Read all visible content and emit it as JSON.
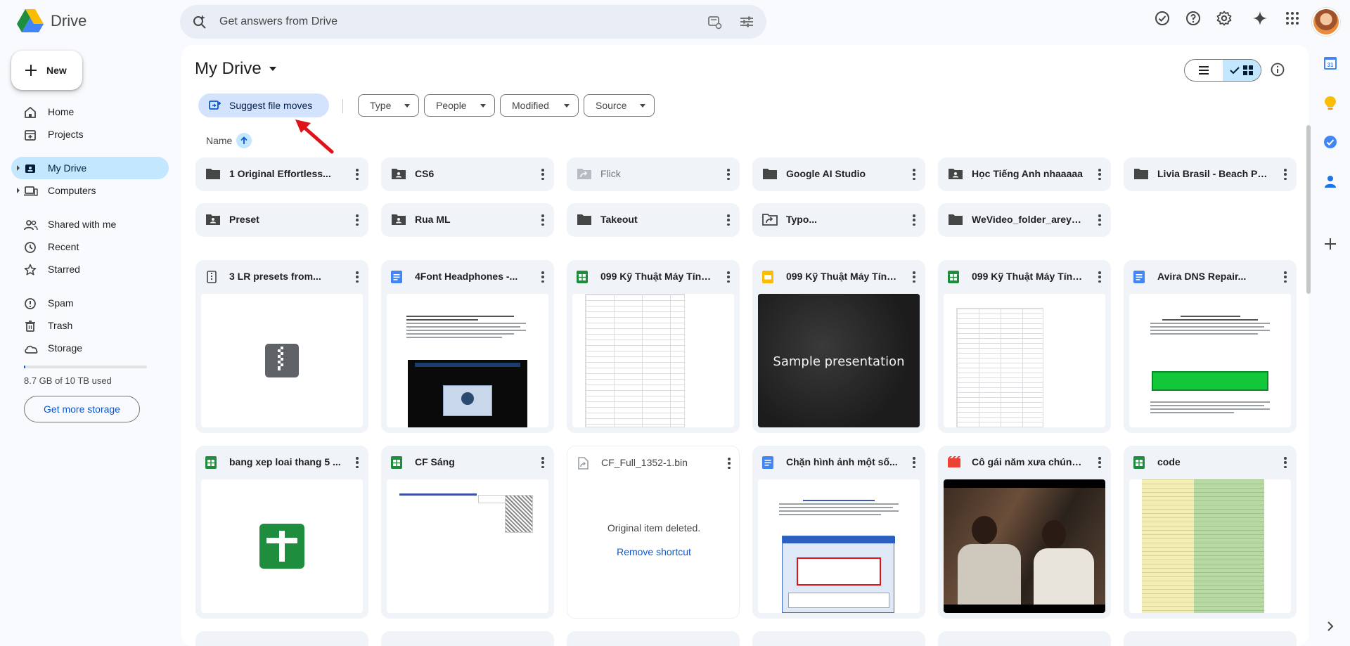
{
  "app": {
    "name": "Drive"
  },
  "search": {
    "placeholder": "Get answers from Drive"
  },
  "sidebar": {
    "new_label": "New",
    "items": [
      {
        "label": "Home"
      },
      {
        "label": "Projects"
      },
      {
        "label": "My Drive"
      },
      {
        "label": "Computers"
      },
      {
        "label": "Shared with me"
      },
      {
        "label": "Recent"
      },
      {
        "label": "Starred"
      },
      {
        "label": "Spam"
      },
      {
        "label": "Trash"
      },
      {
        "label": "Storage"
      }
    ],
    "storage_text": "8.7 GB of 10 TB used",
    "storage_fraction": 0.00087,
    "get_storage_label": "Get more storage"
  },
  "main": {
    "title": "My Drive",
    "suggest_label": "Suggest file moves",
    "filters": [
      {
        "label": "Type"
      },
      {
        "label": "People"
      },
      {
        "label": "Modified"
      },
      {
        "label": "Source"
      }
    ],
    "sort_label": "Name",
    "folders": [
      {
        "name": "1 Original Effortless...",
        "icon": "folder-icon"
      },
      {
        "name": "CS6",
        "icon": "shared-folder-icon"
      },
      {
        "name": "Flick",
        "icon": "folder-shortcut-icon"
      },
      {
        "name": "Google AI Studio",
        "icon": "folder-icon"
      },
      {
        "name": "Học Tiếng Anh nhaaaaa",
        "icon": "shared-folder-icon"
      },
      {
        "name": "Livia Brasil - Beach Pa...",
        "icon": "folder-icon"
      },
      {
        "name": "Preset",
        "icon": "shared-folder-icon"
      },
      {
        "name": "Rua ML",
        "icon": "shared-folder-icon"
      },
      {
        "name": "Takeout",
        "icon": "folder-icon"
      },
      {
        "name": "Typo...",
        "icon": "folder-shortcut-icon"
      },
      {
        "name": "WeVideo_folder_areyo...",
        "icon": "folder-icon"
      }
    ],
    "files": [
      {
        "name": "3 LR presets from...",
        "icon": "zip-shortcut-icon"
      },
      {
        "name": "4Font Headphones -...",
        "icon": "docs-icon"
      },
      {
        "name": "099 Kỹ Thuật Máy Tính...",
        "icon": "sheets-icon"
      },
      {
        "name": "099 Kỹ Thuật Máy Tính...",
        "icon": "slides-icon",
        "preview_text": "Sample presentation"
      },
      {
        "name": "099 Kỹ Thuật Máy Tính...",
        "icon": "sheets-icon"
      },
      {
        "name": "Avira DNS Repair...",
        "icon": "docs-icon"
      },
      {
        "name": "bang xep loai thang 5 ...",
        "icon": "sheets-icon"
      },
      {
        "name": "CF Sáng",
        "icon": "sheets-icon"
      },
      {
        "name": "CF_Full_1352-1.bin",
        "icon": "file-shortcut-icon",
        "deleted_text": "Original item deleted.",
        "remove_label": "Remove shortcut"
      },
      {
        "name": "Chặn hình ảnh một số...",
        "icon": "docs-icon"
      },
      {
        "name": "Cô gái năm xưa chúng ...",
        "icon": "video-icon"
      },
      {
        "name": "code",
        "icon": "sheets-icon"
      }
    ]
  },
  "colors": {
    "accent": "#0b57d0",
    "active_nav": "#c2e7ff",
    "suggest_chip": "#d3e3fd",
    "sheets_green": "#1e8e3e",
    "docs_blue": "#4285f4",
    "slides_yellow": "#fbbc04",
    "video_red": "#ea4335"
  }
}
